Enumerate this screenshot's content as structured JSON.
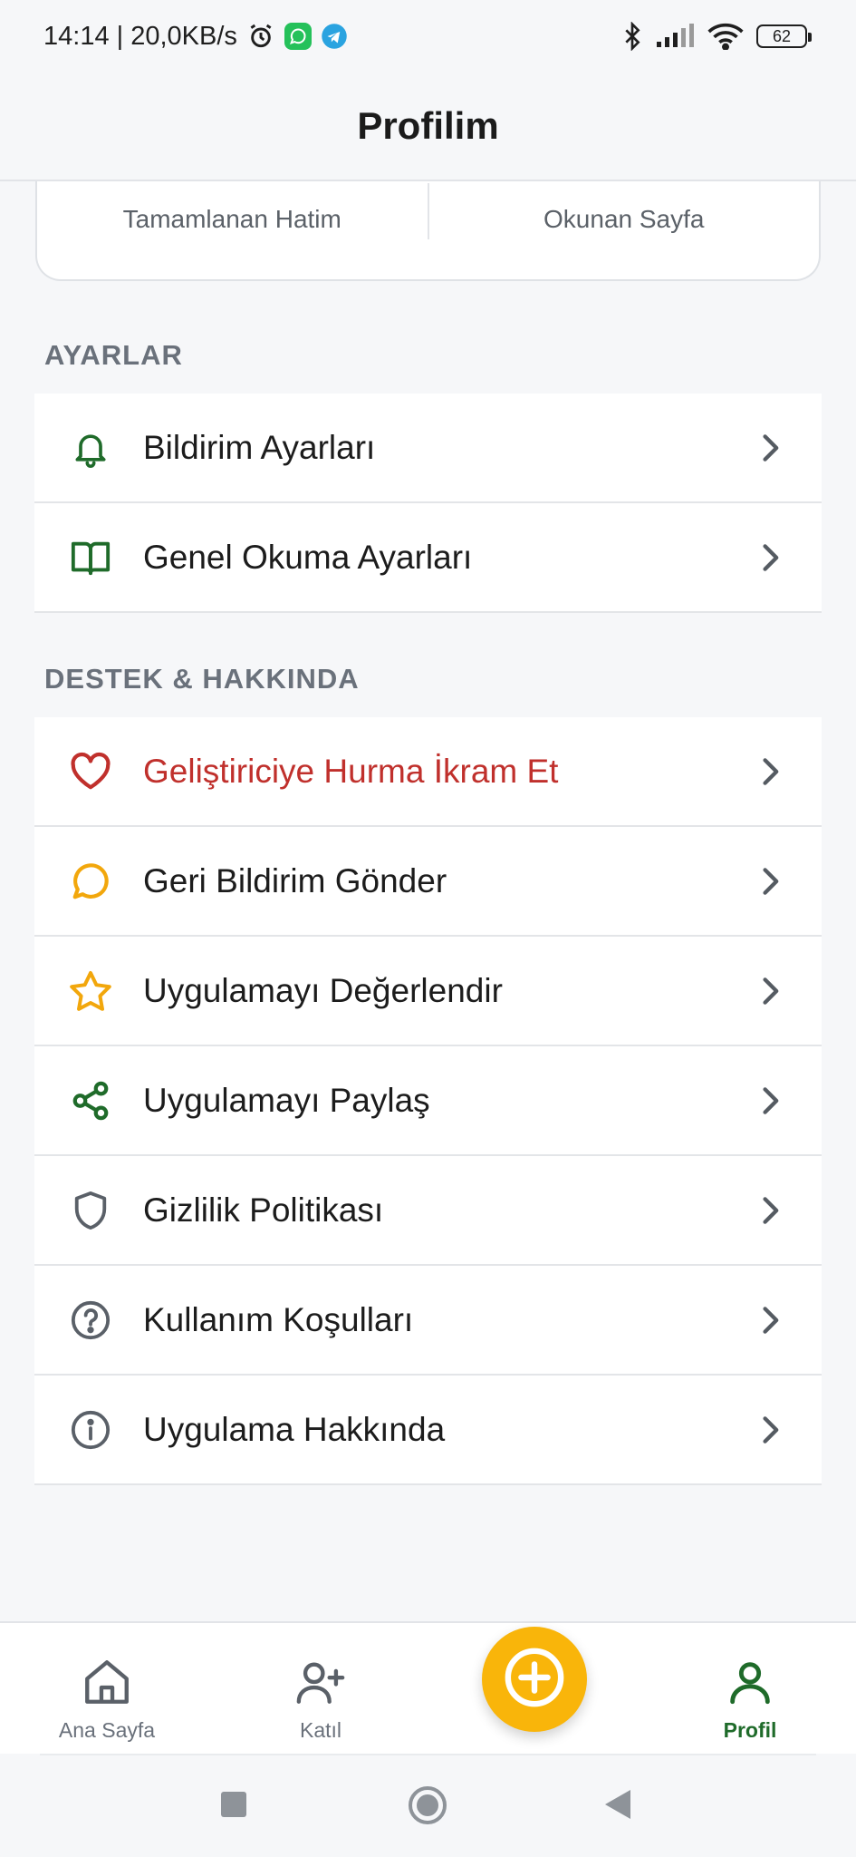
{
  "status_bar": {
    "time_speed": "14:14 | 20,0KB/s",
    "battery": "62",
    "icons": [
      "alarm-icon",
      "whatsapp-icon",
      "telegram-icon",
      "bluetooth-icon",
      "signal-icon",
      "wifi-icon",
      "battery-icon"
    ]
  },
  "header": {
    "title": "Profilim"
  },
  "stats": {
    "completed_label": "Tamamlanan Hatim",
    "pages_label": "Okunan Sayfa"
  },
  "settings": {
    "title": "AYARLAR",
    "items": [
      {
        "label": "Bildirim Ayarları",
        "icon": "bell-icon"
      },
      {
        "label": "Genel Okuma Ayarları",
        "icon": "book-icon"
      }
    ]
  },
  "support": {
    "title": "DESTEK & HAKKINDA",
    "items": [
      {
        "label": "Geliştiriciye Hurma İkram Et",
        "icon": "heart-icon"
      },
      {
        "label": "Geri Bildirim Gönder",
        "icon": "chat-bubble-icon"
      },
      {
        "label": "Uygulamayı Değerlendir",
        "icon": "star-icon"
      },
      {
        "label": "Uygulamayı Paylaş",
        "icon": "share-icon"
      },
      {
        "label": "Gizlilik Politikası",
        "icon": "shield-icon"
      },
      {
        "label": "Kullanım Koşulları",
        "icon": "question-circle-icon"
      },
      {
        "label": "Uygulama Hakkında",
        "icon": "info-circle-icon"
      }
    ]
  },
  "bottom_nav": {
    "home": "Ana Sayfa",
    "join": "Katıl",
    "profile": "Profil",
    "active": "profile"
  },
  "colors": {
    "accent_green": "#1f6b2a",
    "danger_red": "#c0302c",
    "fab_yellow": "#f9b50a",
    "star_yellow": "#f2a70c",
    "muted_gray": "#6a717b"
  }
}
